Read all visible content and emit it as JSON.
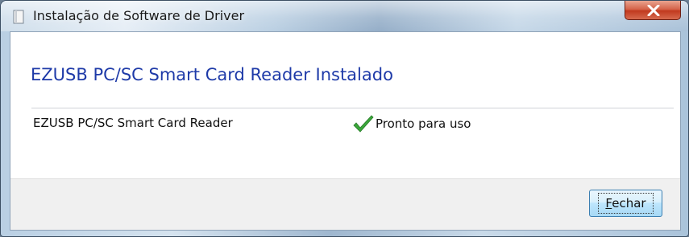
{
  "window": {
    "title": "Instalação de Software de Driver",
    "close_icon": "close-icon"
  },
  "main": {
    "heading": "EZUSB PC/SC Smart Card Reader Instalado",
    "device": {
      "name": "EZUSB PC/SC Smart Card Reader",
      "status_icon": "checkmark-icon",
      "status": "Pronto para uso"
    }
  },
  "footer": {
    "close_button_mnemonic": "F",
    "close_button_rest": "echar"
  },
  "colors": {
    "heading": "#1e3aa8",
    "checkmark": "#3aa63a",
    "close_button_bg": "#c13a1f"
  }
}
